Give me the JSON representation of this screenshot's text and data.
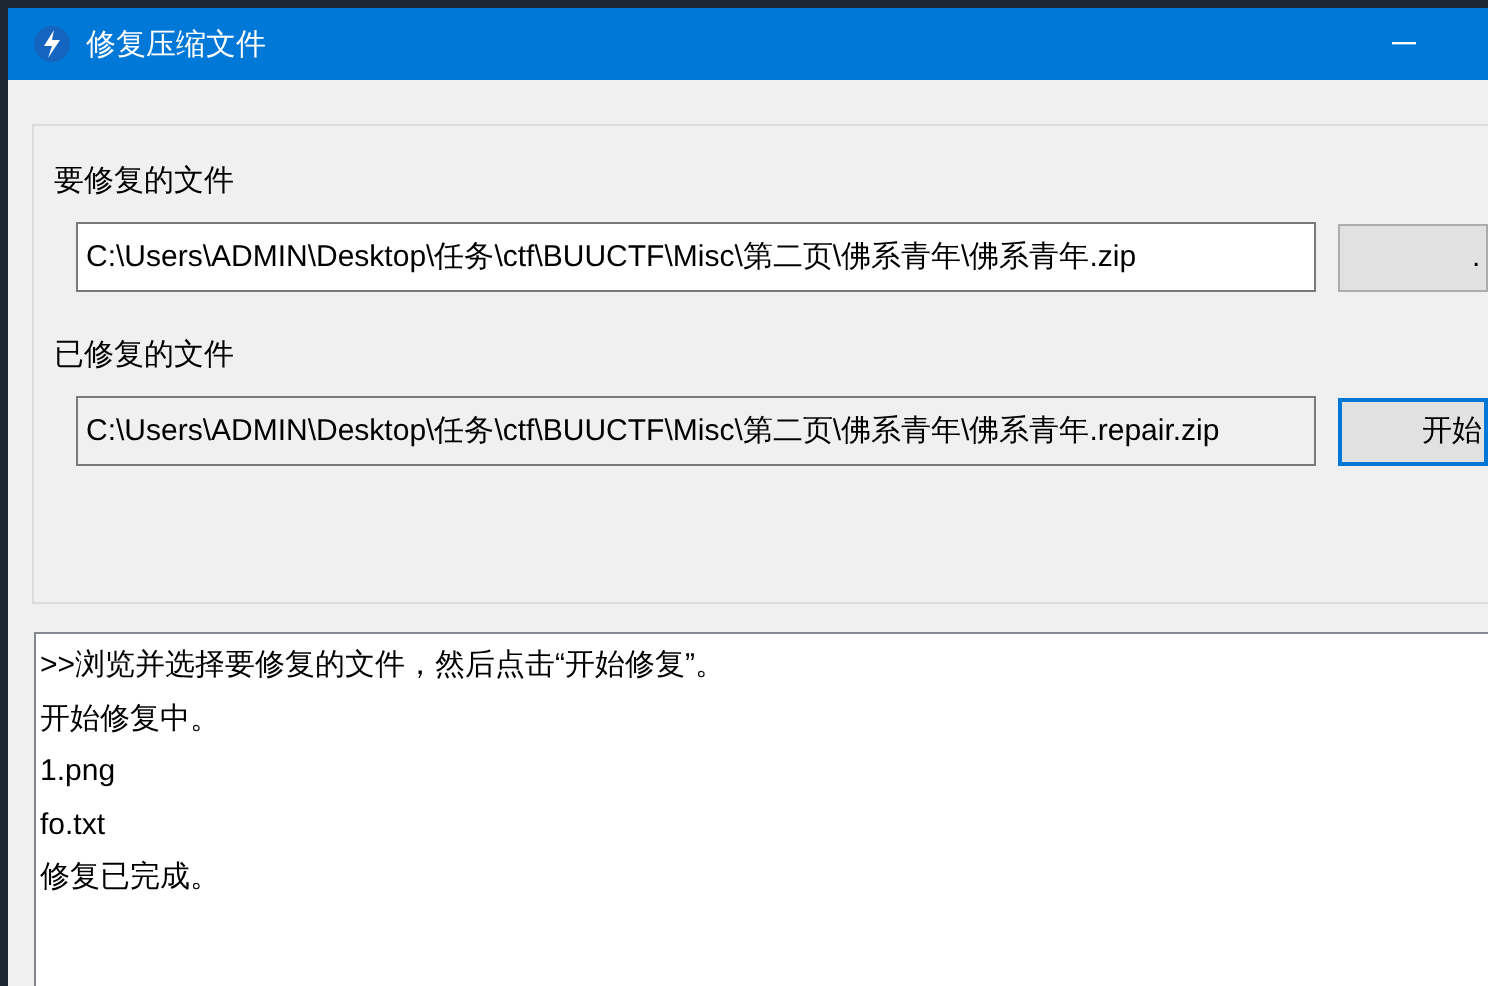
{
  "window": {
    "title": "修复压缩文件"
  },
  "rows": [
    {
      "label": "要修复的文件",
      "value": "C:\\Users\\ADMIN\\Desktop\\任务\\ctf\\BUUCTF\\Misc\\第二页\\佛系青年\\佛系青年.zip",
      "readonly": false,
      "button": ".",
      "focused": false
    },
    {
      "label": "已修复的文件",
      "value": "C:\\Users\\ADMIN\\Desktop\\任务\\ctf\\BUUCTF\\Misc\\第二页\\佛系青年\\佛系青年.repair.zip",
      "readonly": true,
      "button": "开始",
      "focused": true
    }
  ],
  "log": {
    "lines": [
      ">>浏览并选择要修复的文件，然后点击“开始修复”。",
      "开始修复中。",
      "1.png",
      "fo.txt",
      "修复已完成。"
    ]
  }
}
